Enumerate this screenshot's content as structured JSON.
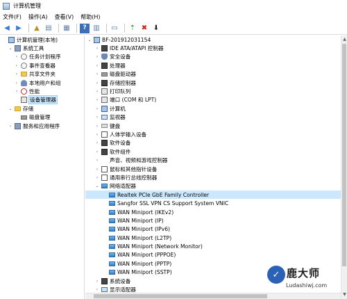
{
  "window": {
    "title": "计算机管理",
    "icon": "computer-management-icon"
  },
  "menu": [
    {
      "label": "文件(F)"
    },
    {
      "label": "操作(A)"
    },
    {
      "label": "查看(V)"
    },
    {
      "label": "帮助(H)"
    }
  ],
  "toolbar": [
    {
      "icon": "back-arrow-icon",
      "glyph": "◀",
      "color": "#3a7bd5"
    },
    {
      "icon": "forward-arrow-icon",
      "glyph": "▶",
      "color": "#3a7bd5"
    },
    {
      "icon": "up-folder-icon",
      "glyph": "▲",
      "color": "#b8912a"
    },
    {
      "icon": "show-hide-tree-icon",
      "glyph": "▤",
      "color": "#5c7fa8"
    },
    {
      "icon": "properties-icon",
      "glyph": "▦",
      "color": "#5c7fa8"
    },
    {
      "icon": "help-icon",
      "glyph": "?",
      "color": "#ffffff",
      "bg": "#3b6fb6"
    },
    {
      "icon": "action-pane-icon",
      "glyph": "▥",
      "color": "#5c7fa8"
    },
    {
      "icon": "monitor-icon",
      "glyph": "▭",
      "color": "#3b6fb6"
    },
    {
      "icon": "update-driver-icon",
      "glyph": "⇡",
      "color": "#2a8a2a"
    },
    {
      "icon": "uninstall-device-icon",
      "glyph": "✖",
      "color": "#d0201a"
    },
    {
      "icon": "scan-hardware-icon",
      "glyph": "⬇",
      "color": "#222222"
    }
  ],
  "left_tree": [
    {
      "label": "计算机管理(本地)",
      "indent": 0,
      "expander": "",
      "icon": "computer-management-icon"
    },
    {
      "label": "系统工具",
      "indent": 1,
      "expander": "⌄",
      "icon": "system-tools-icon"
    },
    {
      "label": "任务计划程序",
      "indent": 2,
      "expander": "›",
      "icon": "task-scheduler-icon"
    },
    {
      "label": "事件查看器",
      "indent": 2,
      "expander": "›",
      "icon": "event-viewer-icon"
    },
    {
      "label": "共享文件夹",
      "indent": 2,
      "expander": "›",
      "icon": "shared-folder-icon"
    },
    {
      "label": "本地用户和组",
      "indent": 2,
      "expander": "›",
      "icon": "local-users-icon"
    },
    {
      "label": "性能",
      "indent": 2,
      "expander": "›",
      "icon": "performance-icon"
    },
    {
      "label": "设备管理器",
      "indent": 2,
      "expander": "",
      "icon": "device-manager-icon",
      "selected": true
    },
    {
      "label": "存储",
      "indent": 1,
      "expander": "⌄",
      "icon": "storage-icon"
    },
    {
      "label": "磁盘管理",
      "indent": 2,
      "expander": "",
      "icon": "disk-management-icon"
    },
    {
      "label": "服务和应用程序",
      "indent": 1,
      "expander": "›",
      "icon": "services-apps-icon"
    }
  ],
  "device_tree": [
    {
      "label": "BF-201912031154",
      "indent": 0,
      "expander": "⌄",
      "icon": "computer-icon"
    },
    {
      "label": "IDE ATA/ATAPI 控制器",
      "indent": 1,
      "expander": "›",
      "icon": "ide-controller-icon"
    },
    {
      "label": "安全设备",
      "indent": 1,
      "expander": "›",
      "icon": "security-device-icon"
    },
    {
      "label": "处理器",
      "indent": 1,
      "expander": "›",
      "icon": "processor-icon"
    },
    {
      "label": "磁盘驱动器",
      "indent": 1,
      "expander": "›",
      "icon": "disk-drive-icon"
    },
    {
      "label": "存储控制器",
      "indent": 1,
      "expander": "›",
      "icon": "storage-controller-icon"
    },
    {
      "label": "打印队列",
      "indent": 1,
      "expander": "›",
      "icon": "print-queue-icon"
    },
    {
      "label": "端口 (COM 和 LPT)",
      "indent": 1,
      "expander": "›",
      "icon": "port-icon"
    },
    {
      "label": "计算机",
      "indent": 1,
      "expander": "›",
      "icon": "computer-icon"
    },
    {
      "label": "监视器",
      "indent": 1,
      "expander": "›",
      "icon": "monitor-icon"
    },
    {
      "label": "键盘",
      "indent": 1,
      "expander": "›",
      "icon": "keyboard-icon"
    },
    {
      "label": "人体学输入设备",
      "indent": 1,
      "expander": "›",
      "icon": "hid-icon"
    },
    {
      "label": "软件设备",
      "indent": 1,
      "expander": "›",
      "icon": "software-device-icon"
    },
    {
      "label": "软件组件",
      "indent": 1,
      "expander": "›",
      "icon": "software-component-icon"
    },
    {
      "label": "声音、视频和游戏控制器",
      "indent": 1,
      "expander": "›",
      "icon": "audio-icon"
    },
    {
      "label": "鼠标和其他指针设备",
      "indent": 1,
      "expander": "›",
      "icon": "mouse-icon"
    },
    {
      "label": "通用串行总线控制器",
      "indent": 1,
      "expander": "›",
      "icon": "usb-icon"
    },
    {
      "label": "网络适配器",
      "indent": 1,
      "expander": "⌄",
      "icon": "network-adapter-icon"
    },
    {
      "label": "Realtek PCIe GbE Family Controller",
      "indent": 2,
      "expander": "",
      "icon": "network-adapter-icon",
      "highlighted": true
    },
    {
      "label": "Sangfor SSL VPN CS Support System VNIC",
      "indent": 2,
      "expander": "",
      "icon": "network-adapter-icon"
    },
    {
      "label": "WAN Miniport (IKEv2)",
      "indent": 2,
      "expander": "",
      "icon": "network-adapter-icon"
    },
    {
      "label": "WAN Miniport (IP)",
      "indent": 2,
      "expander": "",
      "icon": "network-adapter-icon"
    },
    {
      "label": "WAN Miniport (IPv6)",
      "indent": 2,
      "expander": "",
      "icon": "network-adapter-icon"
    },
    {
      "label": "WAN Miniport (L2TP)",
      "indent": 2,
      "expander": "",
      "icon": "network-adapter-icon"
    },
    {
      "label": "WAN Miniport (Network Monitor)",
      "indent": 2,
      "expander": "",
      "icon": "network-adapter-icon"
    },
    {
      "label": "WAN Miniport (PPPOE)",
      "indent": 2,
      "expander": "",
      "icon": "network-adapter-icon"
    },
    {
      "label": "WAN Miniport (PPTP)",
      "indent": 2,
      "expander": "",
      "icon": "network-adapter-icon"
    },
    {
      "label": "WAN Miniport (SSTP)",
      "indent": 2,
      "expander": "",
      "icon": "network-adapter-icon"
    },
    {
      "label": "系统设备",
      "indent": 1,
      "expander": "›",
      "icon": "system-device-icon"
    },
    {
      "label": "显示适配器",
      "indent": 1,
      "expander": "›",
      "icon": "display-adapter-icon"
    }
  ],
  "watermark": {
    "logo_glyph": "✓",
    "text": "鹿大师",
    "url": "Ludashiwj.com"
  }
}
